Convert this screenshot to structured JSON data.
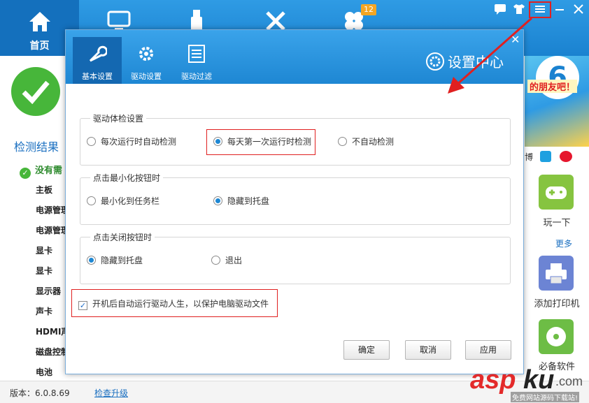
{
  "app": {
    "home_label": "首页",
    "badge_count": "12",
    "version": "版本：6.0.8.69",
    "upgrade_link": "检查升级"
  },
  "left": {
    "result_title": "检测结果",
    "ok_text": "没有需",
    "devices": [
      "主板",
      "电源管理",
      "电源管理",
      "显卡",
      "显卡",
      "显示器",
      "声卡",
      "HDMI声",
      "磁盘控制",
      "电池"
    ]
  },
  "right": {
    "banner_text": "的朋友吧！",
    "banner_badge": "6",
    "item1_label": "玩一下",
    "more_link": "更多",
    "item2_label": "添加打印机",
    "item3_label": "必备软件",
    "small_text": "博"
  },
  "dialog": {
    "title": "设置中心",
    "tabs": [
      {
        "label": "基本设置",
        "icon": "wrench-icon"
      },
      {
        "label": "驱动设置",
        "icon": "gear-icon"
      },
      {
        "label": "驱动过滤",
        "icon": "list-icon"
      }
    ],
    "group1": {
      "legend": "驱动体检设置",
      "options": [
        "每次运行时自动检测",
        "每天第一次运行时检测",
        "不自动检测"
      ],
      "selected": 1
    },
    "group2": {
      "legend": "点击最小化按钮时",
      "options": [
        "最小化到任务栏",
        "隐藏到托盘"
      ],
      "selected": 1
    },
    "group3": {
      "legend": "点击关闭按钮时",
      "options": [
        "隐藏到托盘",
        "退出"
      ],
      "selected": 0
    },
    "autostart_label": "开机后自动运行驱动人生，以保护电脑驱动文件",
    "autostart_checked": true,
    "buttons": {
      "ok": "确定",
      "cancel": "取消",
      "apply": "应用"
    }
  },
  "colors": {
    "accent": "#1e87d3",
    "highlight": "#e02020",
    "success": "#47b63a"
  },
  "watermark": {
    "brand": "aspku",
    "tld": ".com",
    "sub": "免费网站源码下载站!"
  }
}
